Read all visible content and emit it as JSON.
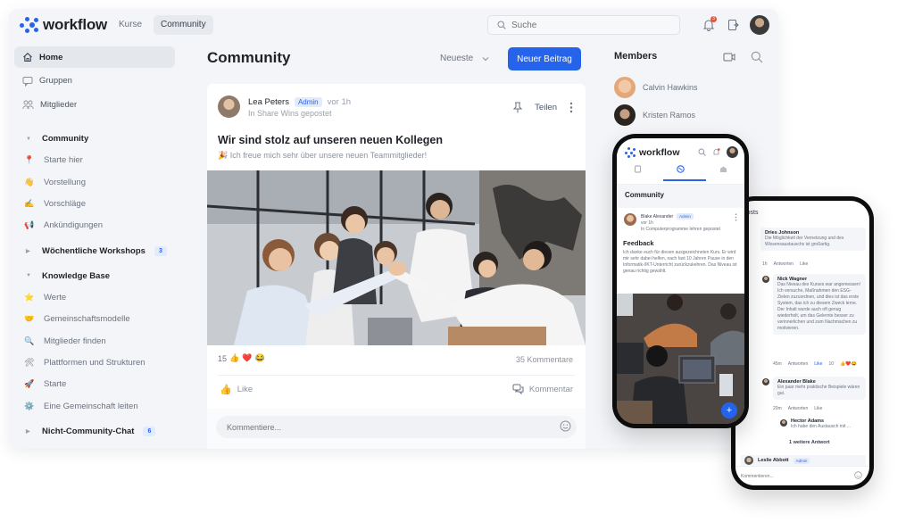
{
  "app": {
    "name": "workflow",
    "accent": "#2563eb",
    "top_tabs": [
      {
        "label": "Kurse",
        "active": false
      },
      {
        "label": "Community",
        "active": true
      }
    ],
    "search": {
      "placeholder": "Suche"
    },
    "notifications": {
      "count": "3"
    }
  },
  "sidebar": {
    "nav": [
      {
        "label": "Home",
        "icon": "home-icon",
        "active": true
      },
      {
        "label": "Gruppen",
        "icon": "chat-icon",
        "active": false
      },
      {
        "label": "Mitglieder",
        "icon": "users-icon",
        "active": false
      }
    ],
    "groups": [
      {
        "label": "Community",
        "expanded": true,
        "items": [
          {
            "label": "Starte hier",
            "emoji": "📍"
          },
          {
            "label": "Vorstellung",
            "emoji": "👋"
          },
          {
            "label": "Vorschläge",
            "emoji": "✍️"
          },
          {
            "label": "Ankündigungen",
            "emoji": "📢"
          }
        ]
      },
      {
        "label": "Wöchentliche Workshops",
        "expanded": false,
        "badge": "3"
      },
      {
        "label": "Knowledge Base",
        "expanded": true,
        "items": [
          {
            "label": "Werte",
            "emoji": "⭐"
          },
          {
            "label": "Gemeinschaftsmodelle",
            "emoji": "🤝"
          },
          {
            "label": "Mitglieder finden",
            "emoji": "🔍"
          },
          {
            "label": "Plattformen und Strukturen",
            "emoji": "🛠"
          },
          {
            "label": "Starte",
            "emoji": "🚀"
          },
          {
            "label": "Eine Gemeinschaft leiten",
            "emoji": "⚙️"
          }
        ]
      },
      {
        "label": "Nicht-Community-Chat",
        "expanded": false,
        "badge": "6"
      }
    ]
  },
  "feed": {
    "title": "Community",
    "sort_label": "Neueste",
    "new_post_label": "Neuer Beitrag",
    "post": {
      "author": "Lea Peters",
      "role": "Admin",
      "time": "vor 1h",
      "location": "In Share Wins gepostet",
      "pin_label": "Teilen",
      "title": "Wir sind stolz auf unseren neuen Kollegen",
      "subtitle": "🎉 Ich freue mich sehr über unsere neuen Teammitglieder!",
      "reaction_count": "15",
      "reactions": [
        "👍",
        "❤️",
        "😂"
      ],
      "comments_count": "35 Kommentare",
      "like_label": "Like",
      "comment_label": "Kommentar",
      "comment_placeholder": "Kommentiere..."
    }
  },
  "members": {
    "title": "Members",
    "list": [
      {
        "name": "Calvin Hawkins"
      },
      {
        "name": "Kristen Ramos"
      }
    ]
  },
  "phone1": {
    "app_name": "workflow",
    "section_title": "Community",
    "post": {
      "author": "Blake Alexander",
      "role": "Admin",
      "time": "vor 1h",
      "location": "In Computerprogramme lehren gepostet",
      "title": "Feedback",
      "body": "Ich danke euch für diesen ausgezeichneten Kurs. Er wird mir sehr dabei helfen, nach fast 10 Jahren Pause in den Informatik-/IKT-Unterricht zurückzukehren. Das Niveau ist genau richtig gewählt."
    },
    "fab_label": "+"
  },
  "phone2": {
    "header": "Posts",
    "comments": [
      {
        "author": "Dries Johnson",
        "text": "Die Möglichkeit der Vernetzung und des Wissensaustauschs ist großartig.",
        "time": "1h",
        "reply": "Antworten",
        "like": "Like"
      },
      {
        "author": "Nick Wagner",
        "text": "Das Niveau des Kurses war angemessen! Ich versuche, Maßnahmen den ESG-Zielen zuzuordnen, und dies ist das erste System, das ich zu diesem Zweck lerne. Der Inhalt wurde auch oft genug wiederholt, um das Gelernte besser zu verinnerlichen und zum Nachmachen zu motivieren.",
        "time": "45m",
        "reply": "Antworten",
        "like": "Like",
        "like_count": "10"
      },
      {
        "author": "Alexander Blake",
        "text": "Ein paar mehr praktische Beispiele wären gut.",
        "time": "20m",
        "reply": "Antworten",
        "like": "Like"
      },
      {
        "author": "Hector Adams",
        "text": "Ich habe den Austausch mit ..."
      }
    ],
    "more_replies": "1 weitere Antwort",
    "last_author": "Leslie Abbott",
    "last_role": "Admin",
    "comment_placeholder": "Kommentieren..."
  }
}
